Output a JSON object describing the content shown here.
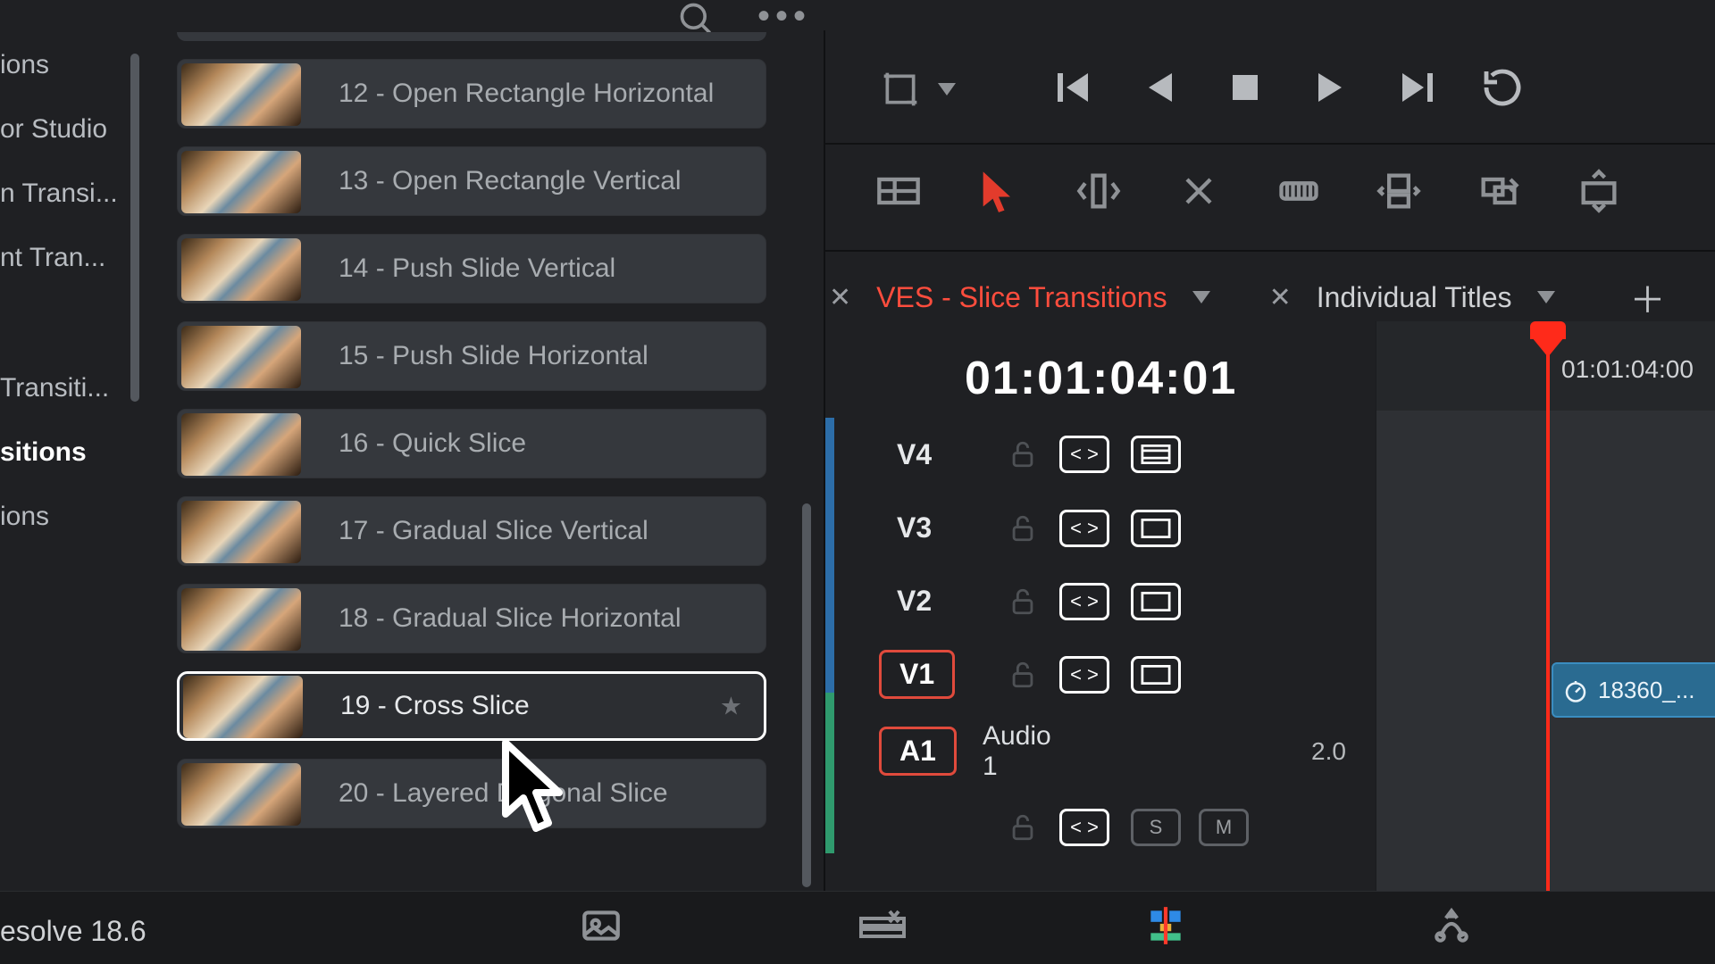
{
  "sidebar": {
    "items": [
      {
        "label": "ions"
      },
      {
        "label": "or Studio"
      },
      {
        "label": "n Transi..."
      },
      {
        "label": "nt Tran..."
      },
      {
        "label": "Transiti..."
      },
      {
        "label": "sitions"
      },
      {
        "label": "ions"
      }
    ],
    "selected_index": 5
  },
  "transitions": {
    "items": [
      {
        "label": "12 - Open Rectangle Horizontal"
      },
      {
        "label": "13 - Open Rectangle Vertical"
      },
      {
        "label": "14 - Push Slide Vertical"
      },
      {
        "label": "15 - Push Slide Horizontal"
      },
      {
        "label": "16 - Quick Slice"
      },
      {
        "label": "17 - Gradual Slice Vertical"
      },
      {
        "label": "18 - Gradual Slice Horizontal"
      },
      {
        "label": "19 - Cross Slice"
      },
      {
        "label": "20 - Layered Diagonal Slice"
      }
    ],
    "selected_index": 7,
    "star_glyph": "★"
  },
  "tabs": {
    "close_glyph": "✕",
    "items": [
      {
        "label": "VES - Slice Transitions",
        "active": true
      },
      {
        "label": "Individual Titles",
        "active": false
      }
    ],
    "add_glyph": "＋"
  },
  "timecode": "01:01:04:01",
  "ruler_timecode": "01:01:04:00",
  "tracks": {
    "video": [
      {
        "name": "V4"
      },
      {
        "name": "V3"
      },
      {
        "name": "V2"
      },
      {
        "name": "V1",
        "boxed": true
      }
    ],
    "audio": {
      "name": "A1",
      "label": "Audio 1",
      "channels": "2.0",
      "solo": "S",
      "mute": "M"
    }
  },
  "clip": {
    "name": "18360_..."
  },
  "app": {
    "version": "esolve 18.6"
  }
}
